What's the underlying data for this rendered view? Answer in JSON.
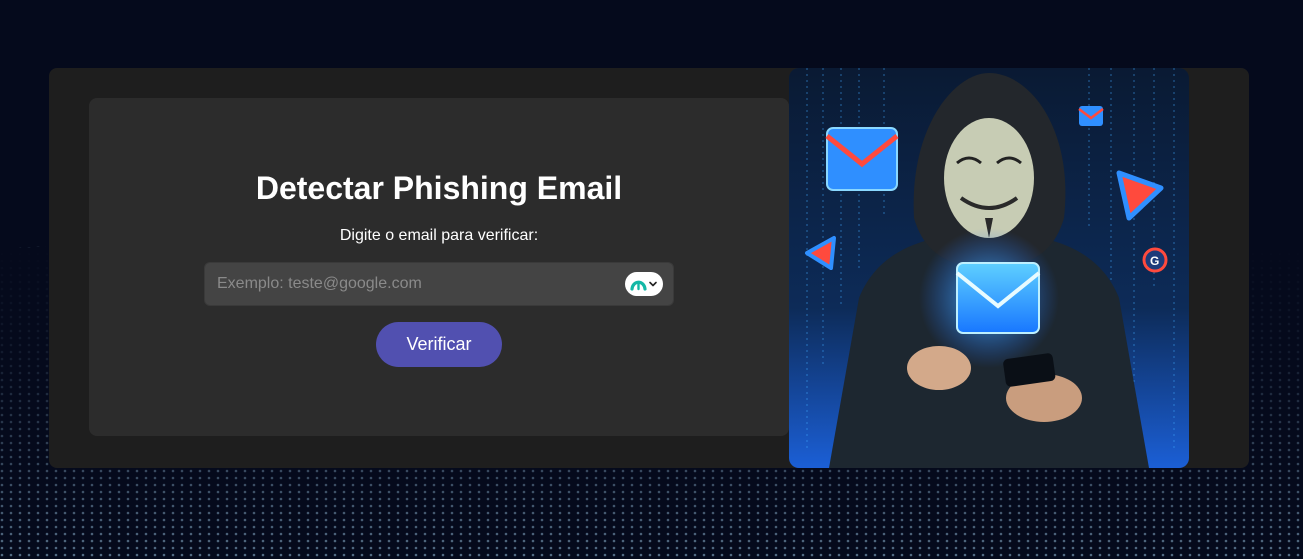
{
  "form": {
    "title": "Detectar Phishing Email",
    "subtitle": "Digite o email para verificar:",
    "email_input": {
      "placeholder": "Exemplo: teste@google.com",
      "value": ""
    },
    "extension_icon": "password-manager-extension-icon",
    "verify_button_label": "Verificar"
  },
  "illustration": {
    "subject": "hooded-hacker-with-mask-and-phone",
    "icons": [
      "envelope-icon",
      "envelope-icon",
      "envelope-icon",
      "alert-triangle-icon",
      "alert-triangle-icon",
      "gmail-g-icon"
    ]
  },
  "colors": {
    "page_background": "#050a1c",
    "card_outer": "#1e1e1e",
    "form_panel": "#2c2c2c",
    "input_background": "#444444",
    "button": "#5150b0",
    "text": "#ffffff"
  }
}
